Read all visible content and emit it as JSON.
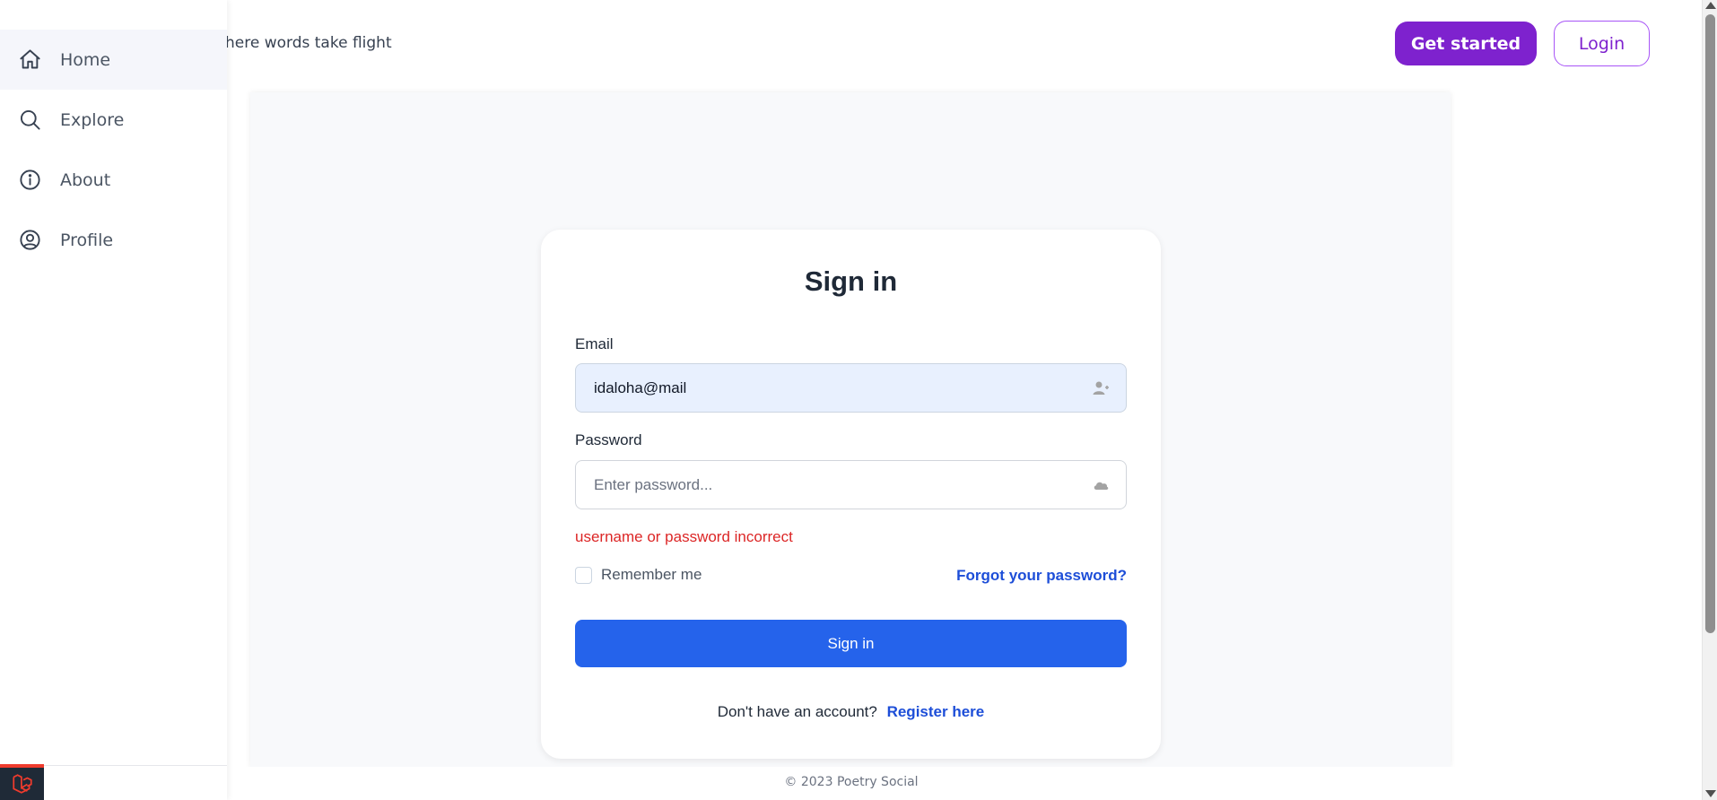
{
  "sidebar": {
    "items": [
      {
        "label": "Home",
        "icon": "home-icon",
        "active": true
      },
      {
        "label": "Explore",
        "icon": "search-icon",
        "active": false
      },
      {
        "label": "About",
        "icon": "info-icon",
        "active": false
      },
      {
        "label": "Profile",
        "icon": "user-circle-icon",
        "active": false
      }
    ],
    "badge_icon": "laravel-logo-icon"
  },
  "header": {
    "tagline": "here words take flight",
    "get_started_label": "Get started",
    "login_label": "Login"
  },
  "signin": {
    "title": "Sign in",
    "email_label": "Email",
    "email_value": "idaloha@mail",
    "password_label": "Password",
    "password_placeholder": "Enter password...",
    "error": "username or password incorrect",
    "remember_label": "Remember me",
    "forgot_label": "Forgot your password?",
    "submit_label": "Sign in",
    "no_account_text": "Don't have an account?",
    "register_label": "Register here"
  },
  "footer": {
    "copyright": "© 2023 Poetry Social"
  },
  "colors": {
    "brand_purple": "#7e22ce",
    "primary_blue": "#2563eb",
    "link_blue": "#1d4ed8",
    "error_red": "#dc2626",
    "laravel_red": "#ef3b2d"
  }
}
